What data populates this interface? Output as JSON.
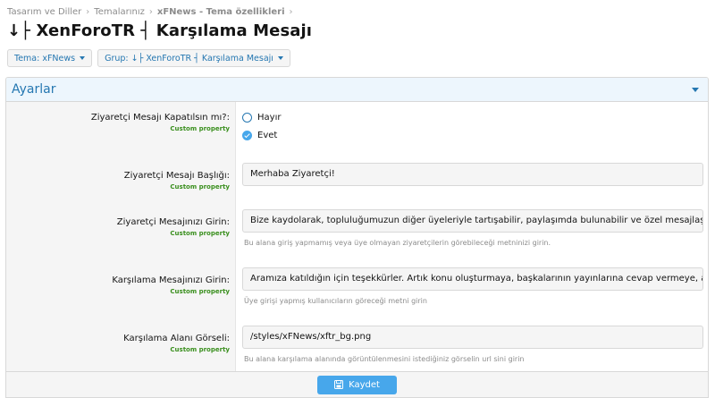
{
  "breadcrumb": {
    "items": [
      "Tasarım ve Diller",
      "Temalarınız",
      "xFNews - Tema özellikleri"
    ],
    "separator": "›"
  },
  "page": {
    "title": "↓├ XenForoTR ┤ Karşılama Mesajı"
  },
  "filters": {
    "theme_label": "Tema: xFNews",
    "group_label": "Grup: ↓├ XenForoTR ┤ Karşılama Mesajı"
  },
  "panel": {
    "title": "Ayarlar"
  },
  "fields": {
    "custom_property": "Custom property",
    "close_message": {
      "label": "Ziyaretçi Mesajı Kapatılsın mı?:",
      "options": [
        "Hayır",
        "Evet"
      ],
      "selected": "Evet"
    },
    "visitor_title": {
      "label": "Ziyaretçi Mesajı Başlığı:",
      "value": "Merhaba Ziyaretçi!"
    },
    "visitor_message": {
      "label": "Ziyaretçi Mesajınızı Girin:",
      "value": "Bize kaydolarak, topluluğumuzun diğer üyeleriyle tartışabilir, paylaşımda bulunabilir ve özel mesajlaşabilirsiniz!",
      "hint": "Bu alana giriş yapmamış veya üye olmayan ziyaretçilerin görebileceği metninizi girin."
    },
    "welcome_message": {
      "label": "Karşılama Mesajınızı Girin:",
      "value": "Aramıza katıldığın için teşekkürler. Artık konu oluşturmaya, başkalarının yayınlarına cevap vermeye, arkadaşlarınla",
      "hint": "Üye girişi yapmış kullanıcıların göreceği metni girin"
    },
    "welcome_image": {
      "label": "Karşılama Alanı Görseli:",
      "value": "/styles/xFNews/xftr_bg.png",
      "hint": "Bu alana karşılama alanında görüntülenmesini istediğiniz görselin url sini girin"
    }
  },
  "actions": {
    "save_label": "Kaydet"
  },
  "colors": {
    "accent": "#2577b1",
    "button": "#47a7eb",
    "custom_property": "#3a8f1e"
  },
  "icons": {
    "save": "floppy-disk-icon",
    "radio_checked": "check-circle-icon"
  }
}
